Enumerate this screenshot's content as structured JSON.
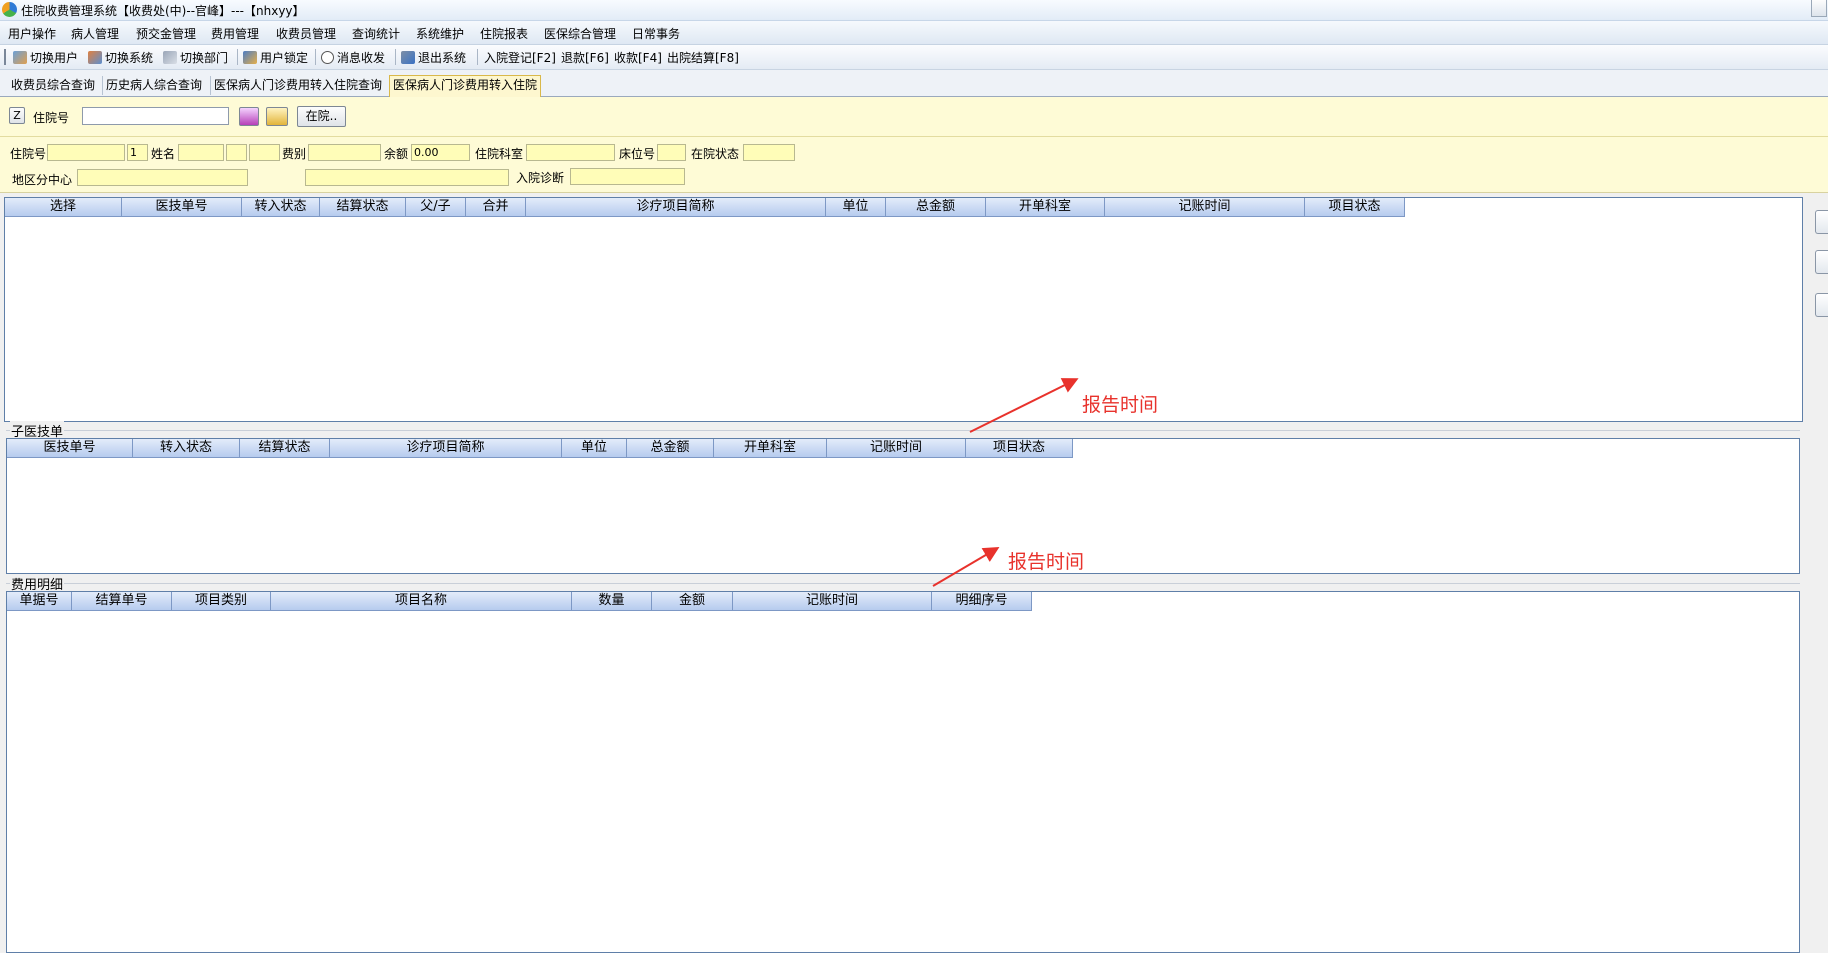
{
  "window": {
    "title": "住院收费管理系统【收费处(中)--官峰】---【nhxyy】"
  },
  "menu": [
    "用户操作",
    "病人管理",
    "预交金管理",
    "费用管理",
    "收费员管理",
    "查询统计",
    "系统维护",
    "住院报表",
    "医保综合管理",
    "日常事务"
  ],
  "toolbar": [
    "切换用户",
    "切换系统",
    "切换部门",
    "用户锁定",
    "消息收发",
    "退出系统",
    "入院登记[F2]",
    "退款[F6]",
    "收款[F4]",
    "出院结算[F8]"
  ],
  "tabs": [
    "收费员综合查询",
    "历史病人综合查询",
    "医保病人门诊费用转入住院查询",
    "医保病人门诊费用转入住院"
  ],
  "search": {
    "z_label": "Z",
    "label": "住院号",
    "value": "",
    "inhosp_button": "在院.."
  },
  "patient": {
    "inpatient_no_label": "住院号",
    "inpatient_no_value": "",
    "seq_value": "1",
    "name_label": "姓名",
    "fee_type_label": "费别",
    "balance_label": "余额",
    "balance_value": "0.00",
    "dept_label": "住院科室",
    "bed_label": "床位号",
    "status_label": "在院状态",
    "region_label": "地区分中心",
    "diagnosis_label": "入院诊断"
  },
  "main_grid": {
    "columns": [
      "选择",
      "医技单号",
      "转入状态",
      "结算状态",
      "父/子",
      "合并",
      "诊疗项目简称",
      "单位",
      "总金额",
      "开单科室",
      "记账时间",
      "项目状态"
    ]
  },
  "sub_grid": {
    "title": "子医技单",
    "columns": [
      "医技单号",
      "转入状态",
      "结算状态",
      "诊疗项目简称",
      "单位",
      "总金额",
      "开单科室",
      "记账时间",
      "项目状态"
    ]
  },
  "fee_grid": {
    "title": "费用明细",
    "columns": [
      "单据号",
      "结算单号",
      "项目类别",
      "项目名称",
      "数量",
      "金额",
      "记账时间",
      "明细序号"
    ]
  },
  "annotations": [
    "报告时间",
    "报告时间"
  ],
  "colors": {
    "annotation": "#e8322c",
    "panel": "#fefbd6",
    "header": "#b6cbee"
  }
}
